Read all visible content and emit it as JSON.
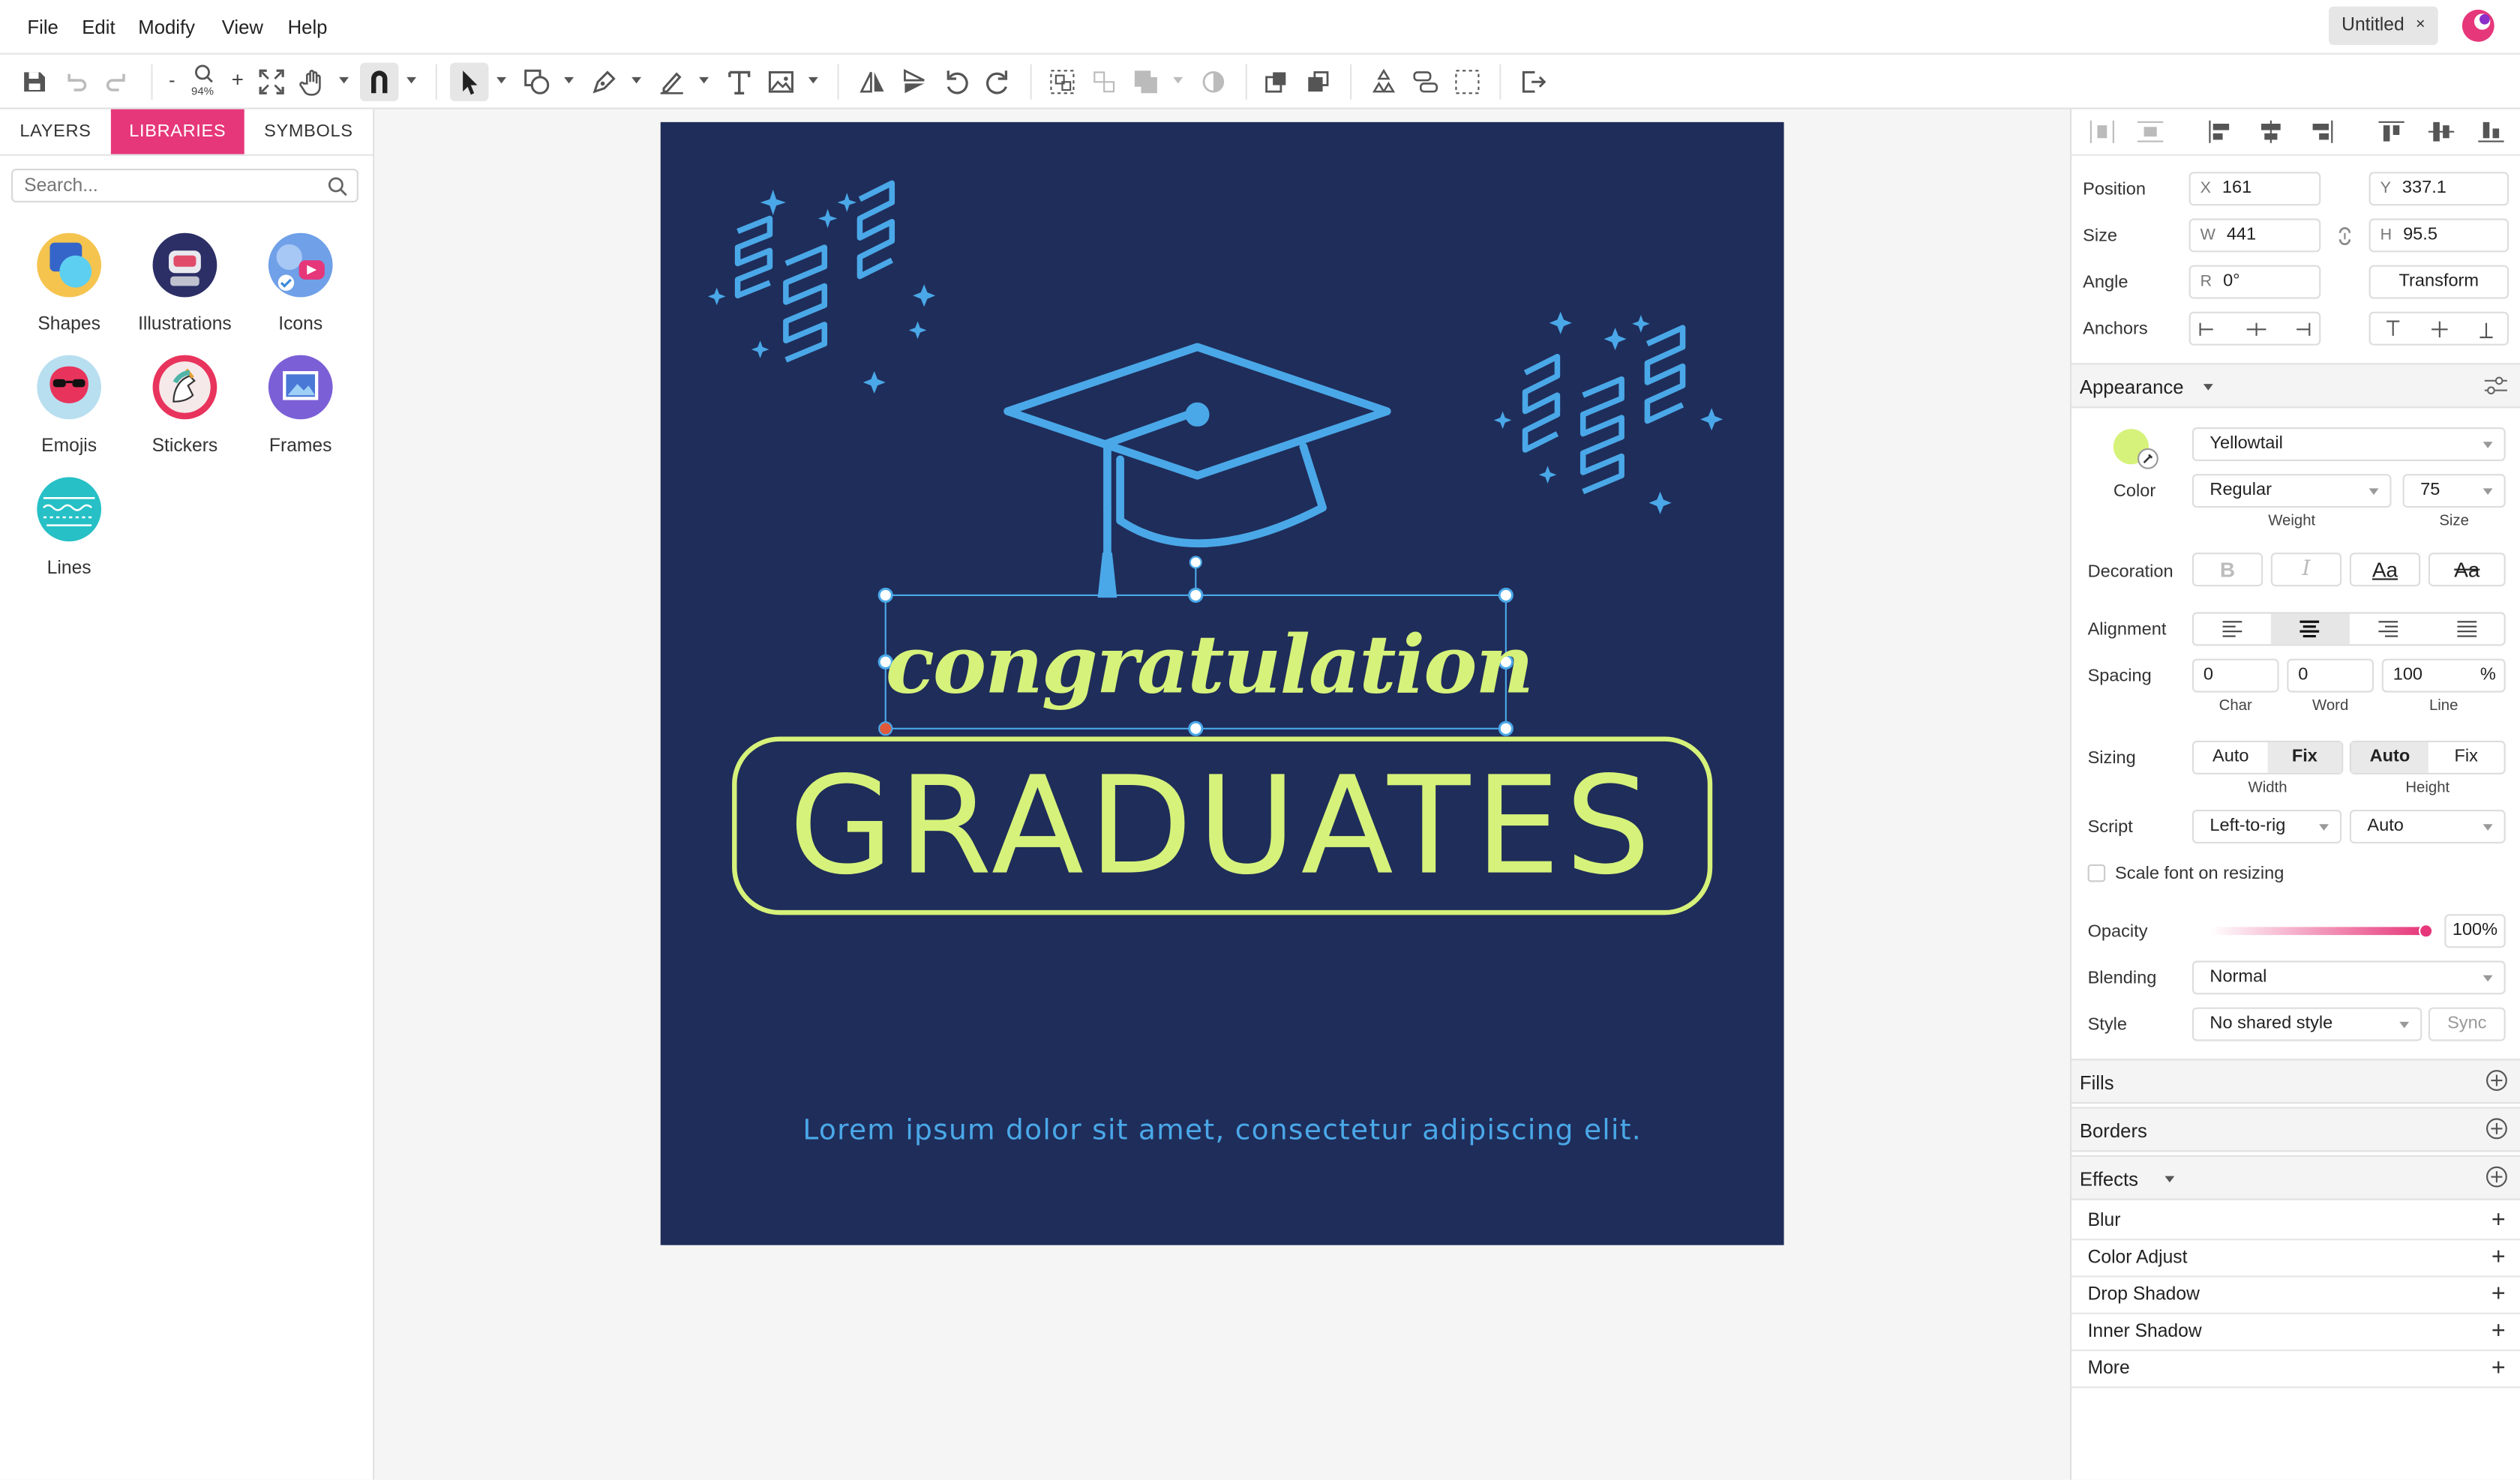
{
  "menu": [
    "File",
    "Edit",
    "Modify",
    "View",
    "Help"
  ],
  "document_tab": {
    "title": "Untitled",
    "close": "×"
  },
  "toolbar": {
    "zoom_out": "-",
    "zoom_level": "94%",
    "zoom_in": "+"
  },
  "left_panel": {
    "tabs": [
      "LAYERS",
      "LIBRARIES",
      "SYMBOLS"
    ],
    "active_tab": "LIBRARIES",
    "search_placeholder": "Search...",
    "libraries": [
      "Shapes",
      "Illustrations",
      "Icons",
      "Emojis",
      "Stickers",
      "Frames",
      "Lines"
    ]
  },
  "artboard": {
    "script_text": "congratulation",
    "headline": "GRADUATES",
    "footer": "Lorem ipsum dolor sit amet, consectetur adipiscing elit.",
    "colors": {
      "background": "#1f2d5a",
      "accent_blue": "#4aa8e8",
      "accent_green": "#d6f27a"
    }
  },
  "right_panel": {
    "position": {
      "label": "Position",
      "x_prefix": "X",
      "x": "161",
      "y_prefix": "Y",
      "y": "337.1"
    },
    "size": {
      "label": "Size",
      "w_prefix": "W",
      "w": "441",
      "h_prefix": "H",
      "h": "95.5"
    },
    "angle": {
      "label": "Angle",
      "r_prefix": "R",
      "value": "0°",
      "transform_button": "Transform"
    },
    "anchors": {
      "label": "Anchors"
    },
    "appearance": {
      "title": "Appearance",
      "color_label": "Color",
      "swatch": "#d6f27a",
      "font": "Yellowtail",
      "weight": "Regular",
      "weight_label": "Weight",
      "size": "75",
      "size_label": "Size",
      "decoration_label": "Decoration",
      "decoration_buttons": [
        "B",
        "I",
        "Aa",
        "Aa"
      ],
      "alignment_label": "Alignment",
      "spacing": {
        "label": "Spacing",
        "char": "0",
        "word": "0",
        "line": "100",
        "unit": "%",
        "char_label": "Char",
        "word_label": "Word",
        "line_label": "Line"
      },
      "sizing": {
        "label": "Sizing",
        "width_opts": [
          "Auto",
          "Fix"
        ],
        "height_opts": [
          "Auto",
          "Fix"
        ],
        "width_label": "Width",
        "height_label": "Height"
      },
      "script": {
        "label": "Script",
        "direction": "Left-to-rig",
        "mode": "Auto"
      },
      "scale_font_label": "Scale font on resizing",
      "opacity": {
        "label": "Opacity",
        "value": "100%",
        "level": 1.0
      },
      "blending": {
        "label": "Blending",
        "value": "Normal"
      },
      "style": {
        "label": "Style",
        "value": "No shared style",
        "sync": "Sync"
      }
    },
    "sections": [
      "Fills",
      "Borders",
      "Effects"
    ],
    "effects": [
      "Blur",
      "Color Adjust",
      "Drop Shadow",
      "Inner Shadow",
      "More"
    ]
  }
}
